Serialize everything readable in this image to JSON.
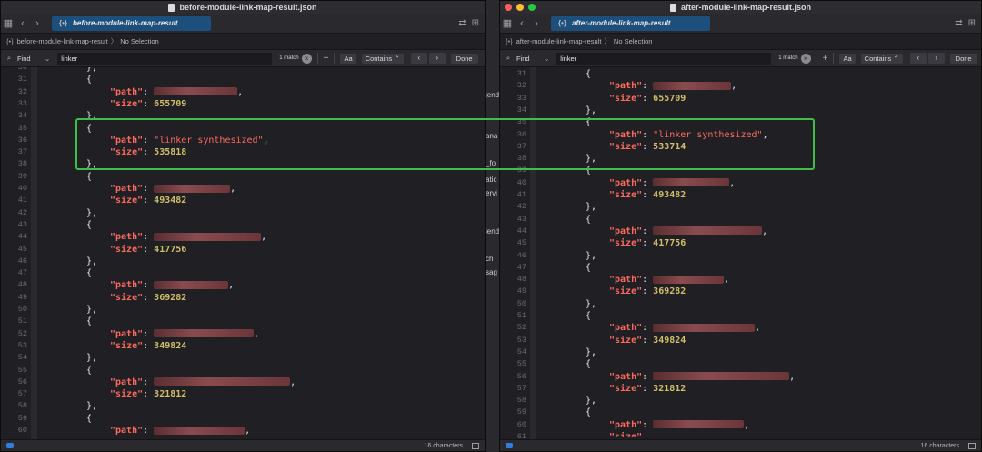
{
  "left_window": {
    "title": "before-module-link-map-result.json",
    "tab_label": "before-module-link-map-result",
    "breadcrumb": {
      "file": "before-module-link-map-result",
      "selection": "No Selection"
    },
    "find": {
      "mode_label": "Find",
      "query": "linker",
      "match_count": "1 match",
      "aa_label": "Aa",
      "contains_label": "Contains",
      "done_label": "Done"
    },
    "status": {
      "characters": "16 characters"
    },
    "lines": [
      {
        "n": "30",
        "t": "close_obj"
      },
      {
        "n": "31",
        "t": "open"
      },
      {
        "n": "32",
        "t": "path",
        "w": 92
      },
      {
        "n": "33",
        "t": "size",
        "v": "655709"
      },
      {
        "n": "34",
        "t": "close"
      },
      {
        "n": "35",
        "t": "open"
      },
      {
        "n": "36",
        "t": "path_str",
        "s": "\"linker synthesized\""
      },
      {
        "n": "37",
        "t": "size",
        "v": "535818"
      },
      {
        "n": "38",
        "t": "close"
      },
      {
        "n": "39",
        "t": "open"
      },
      {
        "n": "40",
        "t": "path",
        "w": 84
      },
      {
        "n": "41",
        "t": "size",
        "v": "493482"
      },
      {
        "n": "42",
        "t": "close"
      },
      {
        "n": "43",
        "t": "open"
      },
      {
        "n": "44",
        "t": "path",
        "w": 118
      },
      {
        "n": "45",
        "t": "size",
        "v": "417756"
      },
      {
        "n": "46",
        "t": "close"
      },
      {
        "n": "47",
        "t": "open"
      },
      {
        "n": "48",
        "t": "path",
        "w": 82
      },
      {
        "n": "49",
        "t": "size",
        "v": "369282"
      },
      {
        "n": "50",
        "t": "close"
      },
      {
        "n": "51",
        "t": "open"
      },
      {
        "n": "52",
        "t": "path",
        "w": 110
      },
      {
        "n": "53",
        "t": "size",
        "v": "349824"
      },
      {
        "n": "54",
        "t": "close"
      },
      {
        "n": "55",
        "t": "open"
      },
      {
        "n": "56",
        "t": "path",
        "w": 150
      },
      {
        "n": "57",
        "t": "size",
        "v": "321812"
      },
      {
        "n": "58",
        "t": "close"
      },
      {
        "n": "59",
        "t": "open"
      },
      {
        "n": "60",
        "t": "path",
        "w": 100
      }
    ]
  },
  "right_window": {
    "title": "after-module-link-map-result.json",
    "tab_label": "after-module-link-map-result",
    "breadcrumb": {
      "file": "after-module-link-map-result",
      "selection": "No Selection"
    },
    "find": {
      "mode_label": "Find",
      "query": "linker",
      "match_count": "1 match",
      "aa_label": "Aa",
      "contains_label": "Contains",
      "done_label": "Done"
    },
    "status": {
      "characters": "16 characters"
    },
    "lines": [
      {
        "n": "31",
        "t": "open"
      },
      {
        "n": "32",
        "t": "path",
        "w": 86
      },
      {
        "n": "33",
        "t": "size",
        "v": "655709"
      },
      {
        "n": "34",
        "t": "close"
      },
      {
        "n": "35",
        "t": "open"
      },
      {
        "n": "36",
        "t": "path_str",
        "s": "\"linker synthesized\""
      },
      {
        "n": "37",
        "t": "size",
        "v": "533714"
      },
      {
        "n": "38",
        "t": "close"
      },
      {
        "n": "39",
        "t": "open"
      },
      {
        "n": "40",
        "t": "path",
        "w": 84
      },
      {
        "n": "41",
        "t": "size",
        "v": "493482"
      },
      {
        "n": "42",
        "t": "close"
      },
      {
        "n": "43",
        "t": "open"
      },
      {
        "n": "44",
        "t": "path",
        "w": 120
      },
      {
        "n": "45",
        "t": "size",
        "v": "417756"
      },
      {
        "n": "46",
        "t": "close"
      },
      {
        "n": "47",
        "t": "open"
      },
      {
        "n": "48",
        "t": "path",
        "w": 78
      },
      {
        "n": "49",
        "t": "size",
        "v": "369282"
      },
      {
        "n": "50",
        "t": "close"
      },
      {
        "n": "51",
        "t": "open"
      },
      {
        "n": "52",
        "t": "path",
        "w": 112
      },
      {
        "n": "53",
        "t": "size",
        "v": "349824"
      },
      {
        "n": "54",
        "t": "close"
      },
      {
        "n": "55",
        "t": "open"
      },
      {
        "n": "56",
        "t": "path",
        "w": 150
      },
      {
        "n": "57",
        "t": "size",
        "v": "321812"
      },
      {
        "n": "58",
        "t": "close"
      },
      {
        "n": "59",
        "t": "open"
      },
      {
        "n": "60",
        "t": "path",
        "w": 100
      },
      {
        "n": "61",
        "t": "size_partial"
      }
    ]
  },
  "background_fragments": [
    "jend",
    "ana",
    "_fo",
    "atic",
    "ervi",
    "iend",
    "ch",
    "sag"
  ],
  "colors": {
    "key": "#fc6a5d",
    "number": "#d0bf69",
    "tab_accent": "#1d4f7c",
    "highlight_box": "#3dbf4a"
  },
  "json_tokens": {
    "key_path": "\"path\"",
    "key_size": "\"size\"",
    "open": "{",
    "close": "},",
    "colon": ": ",
    "comma": ","
  }
}
